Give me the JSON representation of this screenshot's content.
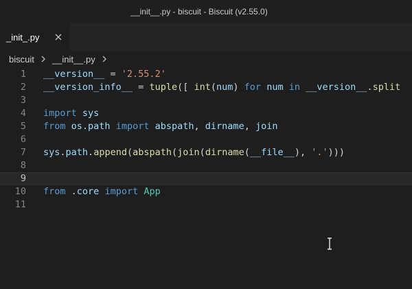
{
  "window": {
    "title": "__init__.py - biscuit - Biscuit (v2.55.0)"
  },
  "tabs": [
    {
      "label": "_init_.py"
    }
  ],
  "breadcrumb": {
    "folder": "biscuit",
    "file": "__init__.py"
  },
  "editor": {
    "current_line": 9,
    "lines": [
      {
        "number": "1",
        "tokens": [
          {
            "t": "__version__",
            "c": "id"
          },
          {
            "t": " = ",
            "c": "pl"
          },
          {
            "t": "'2.55.2'",
            "c": "str"
          }
        ]
      },
      {
        "number": "2",
        "tokens": [
          {
            "t": "__version_info__",
            "c": "id"
          },
          {
            "t": " = ",
            "c": "pl"
          },
          {
            "t": "tuple",
            "c": "fn"
          },
          {
            "t": "([ ",
            "c": "pl"
          },
          {
            "t": "int",
            "c": "fn"
          },
          {
            "t": "(",
            "c": "pl"
          },
          {
            "t": "num",
            "c": "id"
          },
          {
            "t": ") ",
            "c": "pl"
          },
          {
            "t": "for",
            "c": "kw"
          },
          {
            "t": " ",
            "c": "pl"
          },
          {
            "t": "num",
            "c": "id"
          },
          {
            "t": " ",
            "c": "pl"
          },
          {
            "t": "in",
            "c": "kw"
          },
          {
            "t": " ",
            "c": "pl"
          },
          {
            "t": "__version__",
            "c": "id"
          },
          {
            "t": ".",
            "c": "pl"
          },
          {
            "t": "split",
            "c": "fn"
          }
        ]
      },
      {
        "number": "3",
        "tokens": []
      },
      {
        "number": "4",
        "tokens": [
          {
            "t": "import",
            "c": "kw"
          },
          {
            "t": " ",
            "c": "pl"
          },
          {
            "t": "sys",
            "c": "id"
          }
        ]
      },
      {
        "number": "5",
        "tokens": [
          {
            "t": "from",
            "c": "kw"
          },
          {
            "t": " ",
            "c": "pl"
          },
          {
            "t": "os.path",
            "c": "id"
          },
          {
            "t": " ",
            "c": "pl"
          },
          {
            "t": "import",
            "c": "kw"
          },
          {
            "t": " ",
            "c": "pl"
          },
          {
            "t": "abspath",
            "c": "id"
          },
          {
            "t": ", ",
            "c": "pl"
          },
          {
            "t": "dirname",
            "c": "id"
          },
          {
            "t": ", ",
            "c": "pl"
          },
          {
            "t": "join",
            "c": "id"
          }
        ]
      },
      {
        "number": "6",
        "tokens": []
      },
      {
        "number": "7",
        "tokens": [
          {
            "t": "sys",
            "c": "id"
          },
          {
            "t": ".",
            "c": "pl"
          },
          {
            "t": "path",
            "c": "id"
          },
          {
            "t": ".",
            "c": "pl"
          },
          {
            "t": "append",
            "c": "fn"
          },
          {
            "t": "(",
            "c": "pl"
          },
          {
            "t": "abspath",
            "c": "fn"
          },
          {
            "t": "(",
            "c": "pl"
          },
          {
            "t": "join",
            "c": "fn"
          },
          {
            "t": "(",
            "c": "pl"
          },
          {
            "t": "dirname",
            "c": "fn"
          },
          {
            "t": "(",
            "c": "pl"
          },
          {
            "t": "__file__",
            "c": "id"
          },
          {
            "t": "), ",
            "c": "pl"
          },
          {
            "t": "'.'",
            "c": "str"
          },
          {
            "t": ")))",
            "c": "pl"
          }
        ]
      },
      {
        "number": "8",
        "tokens": []
      },
      {
        "number": "9",
        "tokens": []
      },
      {
        "number": "10",
        "tokens": [
          {
            "t": "from",
            "c": "kw"
          },
          {
            "t": " ",
            "c": "pl"
          },
          {
            "t": ".core",
            "c": "id"
          },
          {
            "t": " ",
            "c": "pl"
          },
          {
            "t": "import",
            "c": "kw"
          },
          {
            "t": " ",
            "c": "pl"
          },
          {
            "t": "App",
            "c": "cls"
          }
        ]
      },
      {
        "number": "11",
        "tokens": []
      }
    ]
  },
  "icons": {
    "tab_close": "close-icon",
    "breadcrumb_separator": "chevron-right-icon",
    "mouse_cursor": "text-cursor-icon"
  },
  "colors": {
    "background": "#1e1e1e",
    "keyword": "#569cd6",
    "identifier": "#9cdcfe",
    "function": "#dcdcaa",
    "string": "#ce9178"
  }
}
